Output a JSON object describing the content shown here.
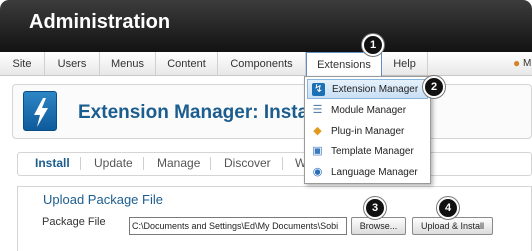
{
  "header": {
    "title": "Administration"
  },
  "menubar": {
    "items": [
      {
        "label": "Site"
      },
      {
        "label": "Users"
      },
      {
        "label": "Menus"
      },
      {
        "label": "Content"
      },
      {
        "label": "Components"
      },
      {
        "label": "Extensions"
      },
      {
        "label": "Help"
      }
    ],
    "user_partial": "M"
  },
  "extensions_menu": {
    "items": [
      {
        "label": "Extension Manager",
        "icon": "extension-manager-icon"
      },
      {
        "label": "Module Manager",
        "icon": "module-manager-icon"
      },
      {
        "label": "Plug-in Manager",
        "icon": "plugin-manager-icon"
      },
      {
        "label": "Template Manager",
        "icon": "template-manager-icon"
      },
      {
        "label": "Language Manager",
        "icon": "language-manager-icon"
      }
    ]
  },
  "page": {
    "title": "Extension Manager: Install"
  },
  "subtabs": [
    {
      "label": "Install"
    },
    {
      "label": "Update"
    },
    {
      "label": "Manage"
    },
    {
      "label": "Discover"
    },
    {
      "label": "W"
    }
  ],
  "upload": {
    "legend": "Upload Package File",
    "package_label": "Package File",
    "package_value": "C:\\Documents and Settings\\Ed\\My Documents\\Sobi",
    "browse_label": "Browse...",
    "upload_label": "Upload & Install"
  },
  "callouts": [
    "1",
    "2",
    "3",
    "4"
  ],
  "colors": {
    "title_blue": "#1c5d8f",
    "header_dark": "#121212",
    "accent_blue": "#2d86c5"
  }
}
